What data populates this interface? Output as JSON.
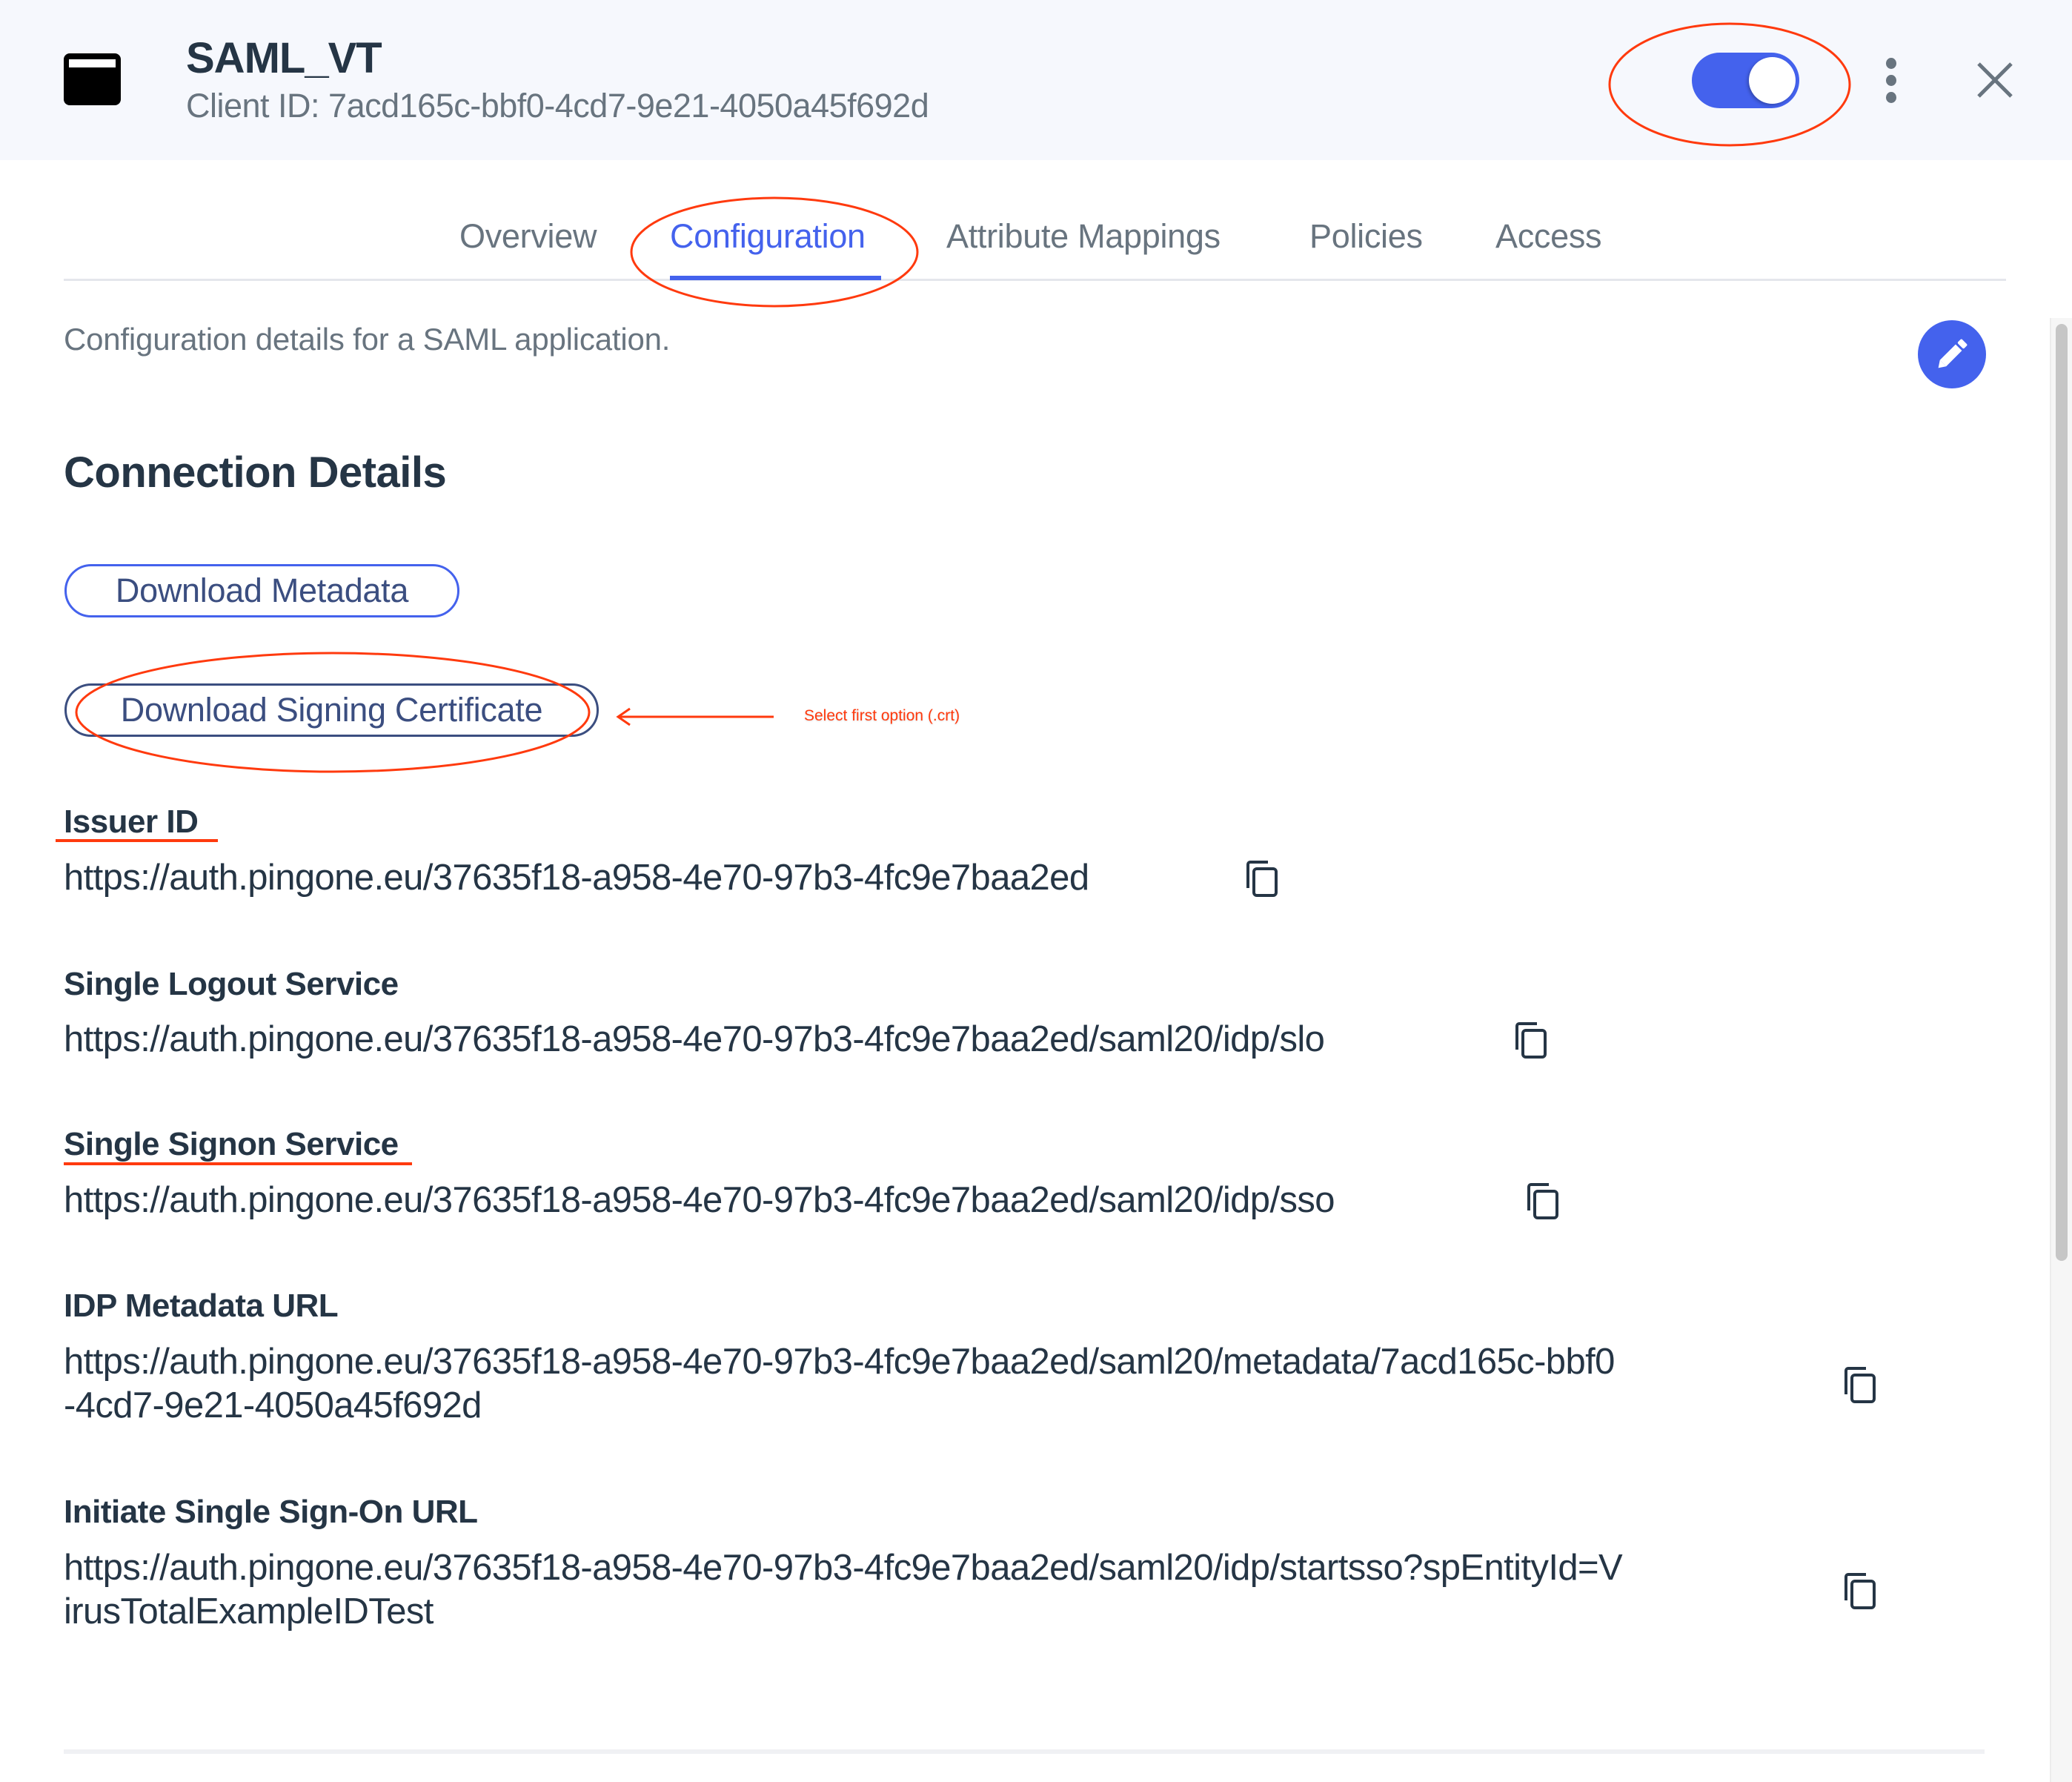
{
  "header": {
    "app_icon": "application-window-icon",
    "title": "SAML_VT",
    "client_id": "Client ID: 7acd165c-bbf0-4cd7-9e21-4050a45f692d",
    "enabled_toggle": {
      "on": true,
      "accent": "#4462ed"
    },
    "more_icon": "kebab-vertical-icon",
    "close_icon": "close-x-icon"
  },
  "tabs": [
    {
      "label": "Overview",
      "active": false
    },
    {
      "label": "Configuration",
      "active": true
    },
    {
      "label": "Attribute Mappings",
      "active": false
    },
    {
      "label": "Policies",
      "active": false
    },
    {
      "label": "Access",
      "active": false
    }
  ],
  "content": {
    "description": "Configuration details for a SAML application.",
    "edit_icon": "pencil-icon",
    "section_heading": "Connection Details",
    "buttons": {
      "download_metadata": "Download Metadata",
      "download_signing_certificate": "Download Signing Certificate"
    },
    "fields": [
      {
        "label": "Issuer ID",
        "value": "https://auth.pingone.eu/37635f18-a958-4e70-97b3-4fc9e7baa2ed"
      },
      {
        "label": "Single Logout Service",
        "value": "https://auth.pingone.eu/37635f18-a958-4e70-97b3-4fc9e7baa2ed/saml20/idp/slo"
      },
      {
        "label": "Single Signon Service",
        "value": "https://auth.pingone.eu/37635f18-a958-4e70-97b3-4fc9e7baa2ed/saml20/idp/sso"
      },
      {
        "label": "IDP Metadata URL",
        "value_line1": "https://auth.pingone.eu/37635f18-a958-4e70-97b3-4fc9e7baa2ed/saml20/metadata/7acd165c-bbf0",
        "value_line2": "-4cd7-9e21-4050a45f692d"
      },
      {
        "label": "Initiate Single Sign-On URL",
        "value_line1": "https://auth.pingone.eu/37635f18-a958-4e70-97b3-4fc9e7baa2ed/saml20/idp/startsso?spEntityId=V",
        "value_line2": "irusTotalExampleIDTest"
      }
    ],
    "copy_icon": "copy-clipboard-icon"
  },
  "annotations": {
    "color": "#ff3a0e",
    "note": "Select first option (.crt)"
  },
  "colors": {
    "accent": "#4462ed",
    "text_primary": "#253545",
    "text_secondary": "#68747f",
    "header_bg": "#f6f8fd",
    "button_navy": "#3b4e80"
  }
}
